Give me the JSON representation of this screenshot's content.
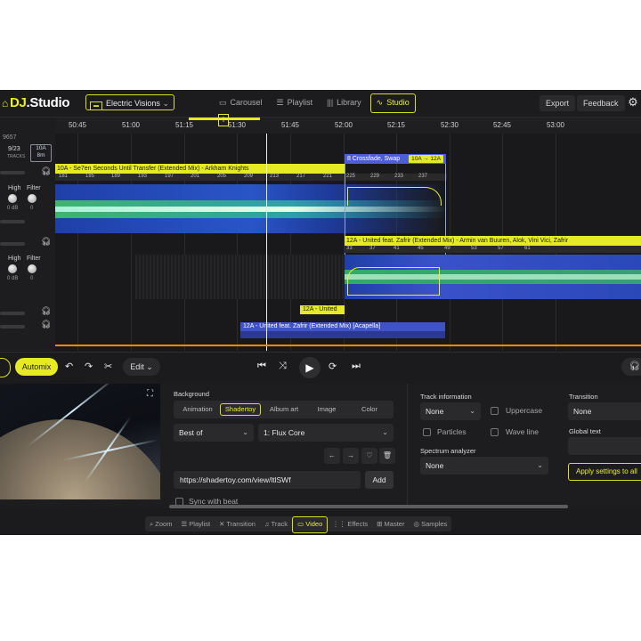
{
  "app": {
    "logo_brand": "DJ",
    "logo_rest": ".Studio",
    "project_name": "Electric Visions",
    "nav_tabs": [
      {
        "label": "Carousel",
        "active": false
      },
      {
        "label": "Playlist",
        "active": false
      },
      {
        "label": "Library",
        "active": false
      },
      {
        "label": "Studio",
        "active": true
      }
    ],
    "export_label": "Export",
    "feedback_label": "Feedback",
    "accent_color": "#e6ea25"
  },
  "left_panel": {
    "bpm_text": "9657",
    "tracks_count": "9/23",
    "tracks_label": "TRACKS",
    "key_top": "10A",
    "key_bottom": "8m",
    "deck1": {
      "high_label": "High",
      "filter_label": "Filter",
      "high_value": "0 dB",
      "filter_value": "0"
    },
    "deck2": {
      "high_label": "High",
      "filter_label": "Filter",
      "high_value": "0 dB",
      "filter_value": "0"
    }
  },
  "ruler": {
    "ticks": [
      "50:45",
      "51:00",
      "51:15",
      "51:30",
      "51:45",
      "52:00",
      "52:15",
      "52:30",
      "52:45",
      "53:00"
    ],
    "controls": [
      "−",
      "+",
      "⏮",
      "⏭"
    ]
  },
  "timeline": {
    "track1_title": "10A - Se7en Seconds Until Transfer (Extended Mix) - Arkham Knights",
    "beat_numbers_1": [
      "181",
      "185",
      "189",
      "193",
      "197",
      "201",
      "205",
      "209",
      "213",
      "217",
      "221",
      "225",
      "229",
      "233",
      "237"
    ],
    "crossfade_label": "8 Crossfade, Swap",
    "crossfade_key": "10A → 12A",
    "track2_title": "12A - United feat. Zafrir (Extended Mix) - Armin van Buuren, Alok, Vini Vici, Zafrir",
    "beat_numbers_2": [
      "33",
      "37",
      "41",
      "45",
      "49",
      "53",
      "57",
      "61"
    ],
    "united_tag": "12A - United",
    "track3_title": "12A - United feat. Zafrir (Extended Mix) [Acapella]"
  },
  "transport": {
    "automix_label": "Automix",
    "edit_label": "Edit"
  },
  "background": {
    "heading": "Background",
    "tabs": [
      {
        "label": "Animation",
        "active": false
      },
      {
        "label": "Shadertoy",
        "active": true
      },
      {
        "label": "Album art",
        "active": false
      },
      {
        "label": "Image",
        "active": false
      },
      {
        "label": "Color",
        "active": false
      }
    ],
    "sort_select": "Best of",
    "shader_select": "1: Flux Core",
    "url_value": "https://shadertoy.com/view/ltlSWf",
    "add_label": "Add",
    "sync_label": "Sync with beat"
  },
  "track_info": {
    "heading": "Track information",
    "select_value": "None",
    "uppercase_label": "Uppercase",
    "particles_label": "Particles",
    "waveline_label": "Wave line",
    "spectrum_heading": "Spectrum analyzer",
    "spectrum_value": "None"
  },
  "transition": {
    "heading": "Transition",
    "select_value": "None",
    "global_text_heading": "Global text",
    "apply_label": "Apply settings to all"
  },
  "footer": {
    "items": [
      {
        "label": "Zoom",
        "icon": "zoom-icon",
        "active": false
      },
      {
        "label": "Playlist",
        "icon": "playlist-icon",
        "active": false
      },
      {
        "label": "Transition",
        "icon": "transition-icon",
        "active": false
      },
      {
        "label": "Track",
        "icon": "music-note-icon",
        "active": false
      },
      {
        "label": "Video",
        "icon": "video-icon",
        "active": true
      },
      {
        "label": "Effects",
        "icon": "effects-icon",
        "active": false
      },
      {
        "label": "Master",
        "icon": "master-icon",
        "active": false
      },
      {
        "label": "Samples",
        "icon": "samples-icon",
        "active": false
      }
    ]
  }
}
